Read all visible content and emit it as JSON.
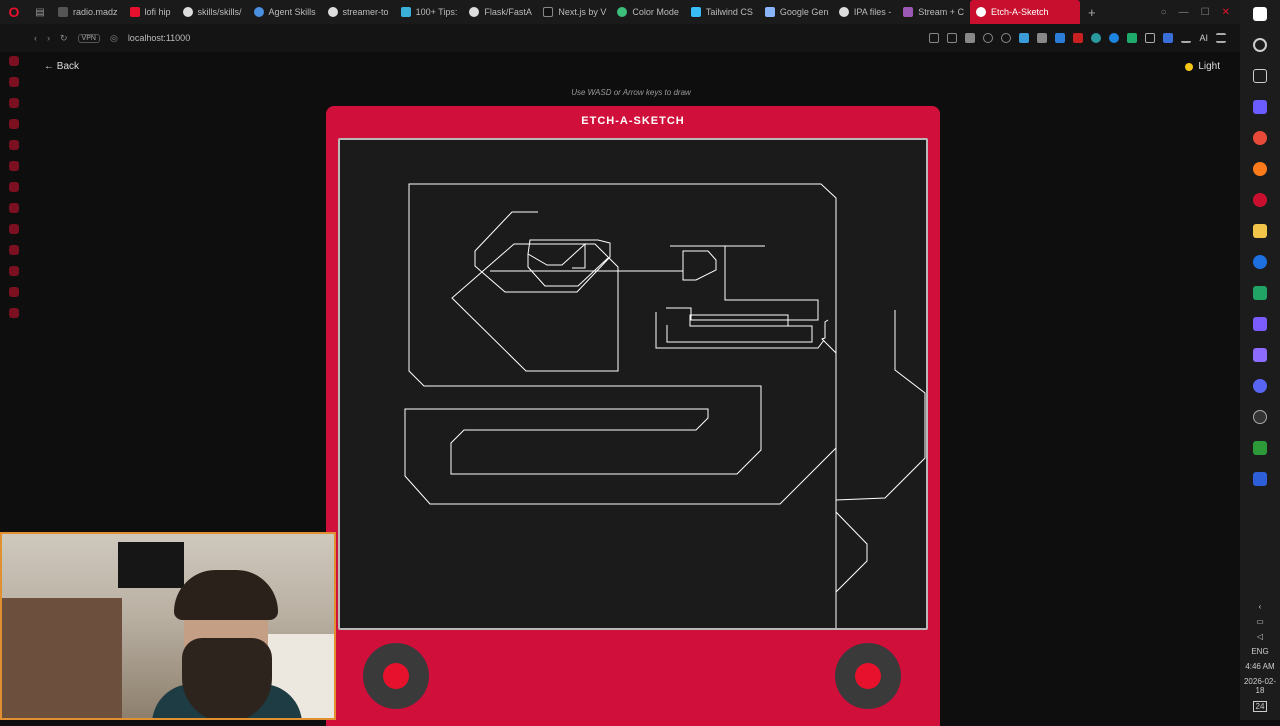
{
  "browser": {
    "tabs": [
      {
        "label": "radio.madz",
        "color": "#555555"
      },
      {
        "label": "lofi hip",
        "color": "#e8112d"
      },
      {
        "label": "skills/skills/",
        "color": "#dddddd"
      },
      {
        "label": "Agent Skills",
        "color": "#4a90e2"
      },
      {
        "label": "streamer-to",
        "color": "#dddddd"
      },
      {
        "label": "100+ Tips:",
        "color": "#3ab0d8"
      },
      {
        "label": "Flask/FastA",
        "color": "#dddddd"
      },
      {
        "label": "Next.js by V",
        "color": "#111111"
      },
      {
        "label": "Color Mode",
        "color": "#3bbf7a"
      },
      {
        "label": "Tailwind CS",
        "color": "#38bdf8"
      },
      {
        "label": "Google Gen",
        "color": "#8ab4f8"
      },
      {
        "label": "IPA files -",
        "color": "#dddddd"
      },
      {
        "label": "Stream + C",
        "color": "#9b59b6"
      },
      {
        "label": "Etch-A-Sketch",
        "color": "#ffffff"
      }
    ],
    "new_tab": "+",
    "vpn": "VPN",
    "url": "localhost:11000",
    "ai_label": "AI"
  },
  "page": {
    "back_label": "← Back",
    "theme_label": "Light",
    "instructions": "Use WASD or Arrow keys to draw",
    "device_title": "ETCH-A-SKETCH"
  },
  "taskbar": {
    "language": "ENG",
    "time": "4:46 AM",
    "date": "2026-02-18",
    "notifications": "24"
  },
  "colors": {
    "device": "#d0103a",
    "screen": "#1b1b1b",
    "stroke": "#ffffff",
    "knob": "#3a3a3a",
    "knob_core": "#e8112d"
  }
}
